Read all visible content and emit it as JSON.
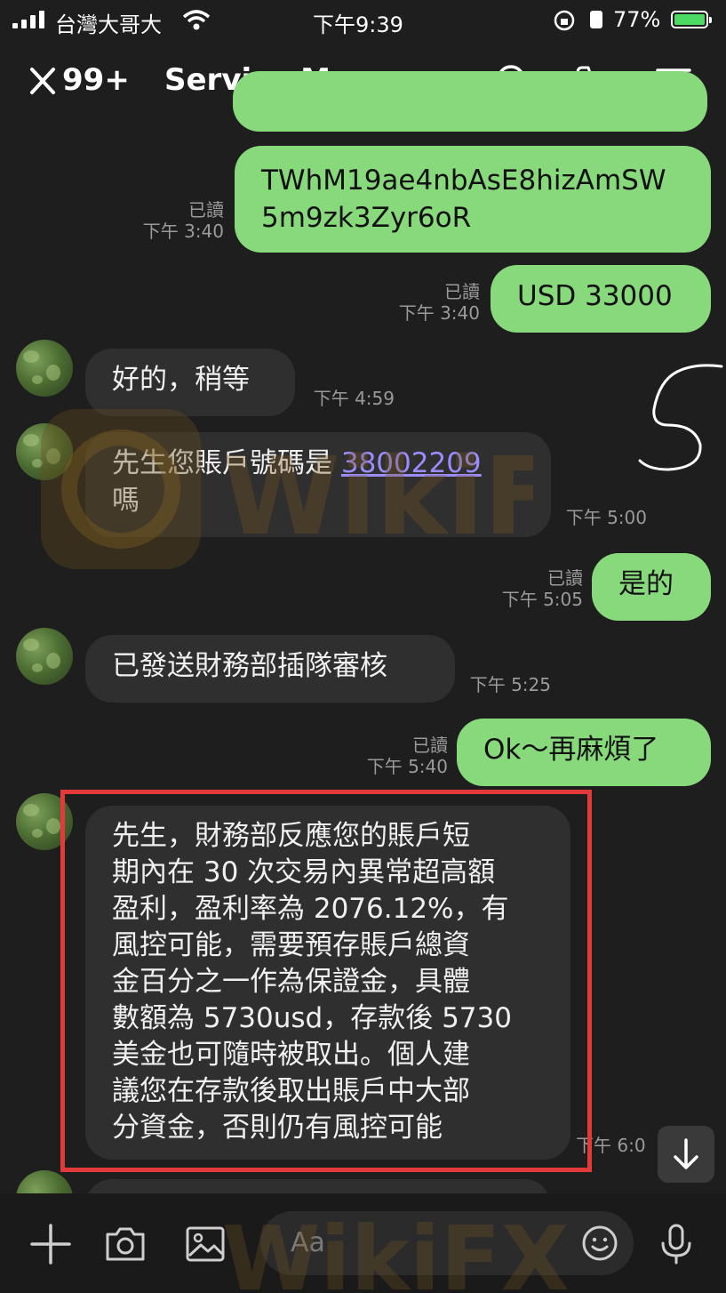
{
  "status_bar": {
    "carrier": "台灣大哥大",
    "time": "下午9:39",
    "battery": "77%"
  },
  "header": {
    "unread_count": "99+",
    "title": "Service Manager"
  },
  "messages": [
    {
      "side": "out",
      "text": "TWhM19ae4nbAsE8hizAmSW\n5m9zk3Zyr6oR",
      "read": "已讀",
      "time": "下午 3:40"
    },
    {
      "side": "out",
      "text": "USD 33000",
      "read": "已讀",
      "time": "下午 3:40"
    },
    {
      "side": "in",
      "text": "好的，稍等",
      "time": "下午 4:59"
    },
    {
      "side": "in",
      "text_before": "先生您賬戶號碼是 ",
      "link": "38002209",
      "text_after": "嗎",
      "time": "下午 5:00"
    },
    {
      "side": "out",
      "text": "是的",
      "read": "已讀",
      "time": "下午 5:05"
    },
    {
      "side": "in",
      "text": "已發送財務部插隊審核",
      "time": "下午 5:25"
    },
    {
      "side": "out",
      "text": "Ok～再麻煩了",
      "read": "已讀",
      "time": "下午 5:40"
    },
    {
      "side": "in",
      "lines": [
        "先生，財務部反應您的賬戶短",
        "期內在 30 次交易內異常超高額",
        "盈利，盈利率為 2076.12%，有",
        "風控可能，需要預存賬戶總資",
        "金百分之一作為保證金，具體",
        "數額為 5730usd，存款後 5730",
        "美金也可隨時被取出。個人建",
        "議您在存款後取出賬戶中大部",
        "分資金，否則仍有風控可能"
      ],
      "time": "下午 6:0"
    }
  ],
  "input": {
    "placeholder": "Aa"
  },
  "watermark": "WikiFX",
  "colors": {
    "background": "#1e1e1e",
    "incoming_bubble": "#2f2f2f",
    "outgoing_bubble": "#87d97b",
    "highlight_box": "#e23a3a",
    "link": "#9b8cff"
  }
}
